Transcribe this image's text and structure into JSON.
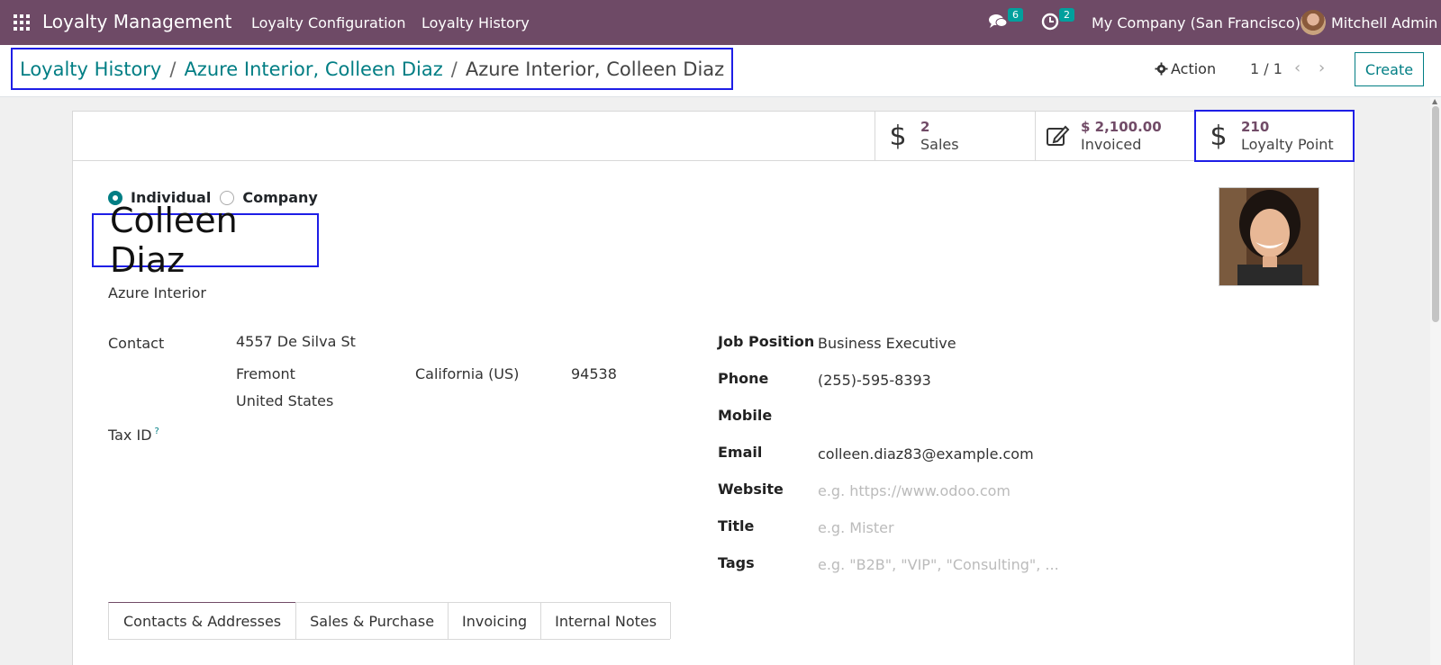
{
  "navbar": {
    "app_name": "Loyalty Management",
    "menu": [
      "Loyalty Configuration",
      "Loyalty History"
    ],
    "messages_count": "6",
    "activities_count": "2",
    "company": "My Company (San Francisco)",
    "user": "Mitchell Admin"
  },
  "breadcrumb": {
    "items": [
      "Loyalty History",
      "Azure Interior, Colleen Diaz",
      "Azure Interior, Colleen Diaz"
    ]
  },
  "control": {
    "action_label": "Action",
    "pager": "1 / 1",
    "create_label": "Create"
  },
  "stat_buttons": [
    {
      "value": "2",
      "label": "Sales",
      "icon": "dollar-icon"
    },
    {
      "value": "$ 2,100.00",
      "label": "Invoiced",
      "icon": "edit-icon"
    },
    {
      "value": "210",
      "label": "Loyalty Point",
      "icon": "dollar-icon"
    }
  ],
  "partner": {
    "type_options": [
      "Individual",
      "Company"
    ],
    "selected_type": "Individual",
    "name": "Colleen Diaz",
    "company": "Azure Interior"
  },
  "address": {
    "label": "Contact",
    "street": "4557 De Silva St",
    "city": "Fremont",
    "state": "California (US)",
    "zip": "94538",
    "country": "United States",
    "tax_label": "Tax ID",
    "tax_help": "?"
  },
  "right_fields": [
    {
      "label": "Job Position",
      "value": "Business Executive",
      "placeholder": false
    },
    {
      "label": "Phone",
      "value": "(255)-595-8393",
      "placeholder": false
    },
    {
      "label": "Mobile",
      "value": "",
      "placeholder": false
    },
    {
      "label": "Email",
      "value": "colleen.diaz83@example.com",
      "placeholder": false
    },
    {
      "label": "Website",
      "value": "e.g. https://www.odoo.com",
      "placeholder": true
    },
    {
      "label": "Title",
      "value": "e.g. Mister",
      "placeholder": true
    },
    {
      "label": "Tags",
      "value": "e.g. \"B2B\", \"VIP\", \"Consulting\", ...",
      "placeholder": true
    }
  ],
  "tabs": [
    "Contacts & Addresses",
    "Sales & Purchase",
    "Invoicing",
    "Internal Notes"
  ],
  "colors": {
    "navbar": "#6e4a66",
    "link": "#017e84",
    "highlight": "#1e1ee6"
  }
}
